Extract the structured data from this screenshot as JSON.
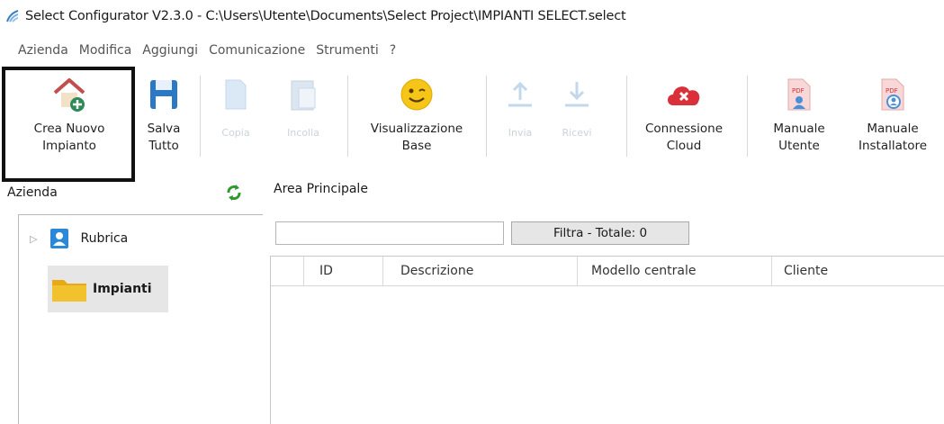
{
  "window": {
    "title": "Select Configurator V2.3.0 - C:\\Users\\Utente\\Documents\\Select Project\\IMPIANTI SELECT.select"
  },
  "menu": [
    "Azienda",
    "Modifica",
    "Aggiungi",
    "Comunicazione",
    "Strumenti",
    "?"
  ],
  "toolbar": {
    "new_plant": {
      "line1": "Crea Nuovo",
      "line2": "Impianto",
      "icon": "new-plant-icon"
    },
    "save_all": {
      "line1": "Salva",
      "line2": "Tutto",
      "icon": "save-icon"
    },
    "copy": {
      "line1": "Copia",
      "icon": "copy-icon"
    },
    "paste": {
      "line1": "Incolla",
      "icon": "paste-icon"
    },
    "view_base": {
      "line1": "Visualizzazione",
      "line2": "Base",
      "icon": "smiley-icon"
    },
    "send": {
      "line1": "Invia",
      "icon": "upload-icon"
    },
    "receive": {
      "line1": "Ricevi",
      "icon": "download-icon"
    },
    "cloud": {
      "line1": "Connessione",
      "line2": "Cloud",
      "icon": "cloud-disconnected-icon"
    },
    "user_manual": {
      "line1": "Manuale",
      "line2": "Utente",
      "icon": "pdf-user-icon"
    },
    "installer_manual": {
      "line1": "Manuale",
      "line2": "Installatore",
      "icon": "pdf-installer-icon"
    }
  },
  "left_panel": {
    "header": "Azienda",
    "tree": [
      {
        "label": "Rubrica",
        "icon": "contacts-icon"
      },
      {
        "label": "Impianti",
        "icon": "folder-icon",
        "selected": true
      }
    ]
  },
  "main": {
    "title": "Area Principale",
    "filter": {
      "value": "",
      "button_label": "Filtra - Totale: 0"
    },
    "columns": [
      "ID",
      "Descrizione",
      "Modello centrale",
      "Cliente"
    ]
  },
  "colors": {
    "highlight_border": "#111111",
    "refresh_green": "#2e9a2e",
    "cloud_red": "#d9303a",
    "save_blue": "#2b78c4",
    "folder_yellow": "#f2c12e"
  }
}
